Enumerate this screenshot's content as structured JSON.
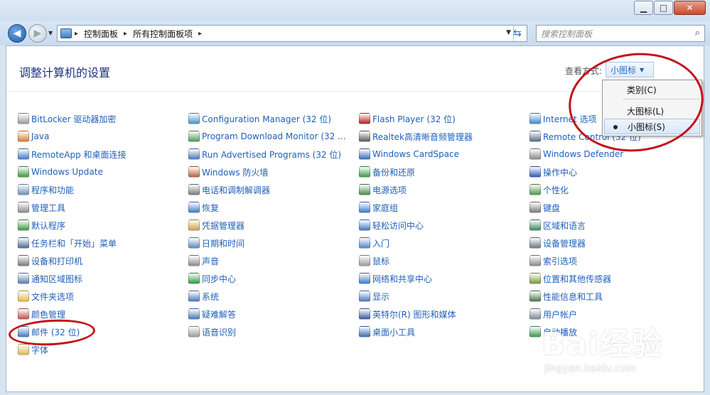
{
  "window": {
    "minimize_glyph": "▁",
    "maximize_glyph": "□",
    "close_glyph": "✕"
  },
  "nav": {
    "back_glyph": "◀",
    "forward_glyph": "▶",
    "breadcrumb": [
      "控制面板",
      "所有控制面板项"
    ],
    "separator": "▸",
    "search_placeholder": "搜索控制面板"
  },
  "header": {
    "title": "调整计算机的设置",
    "view_by_label": "查看方式:",
    "view_selected": "小图标"
  },
  "view_menu": {
    "items": [
      "类别(C)",
      "大图标(L)",
      "小图标(S)"
    ],
    "checked_index": 2
  },
  "columns": [
    [
      {
        "label": "BitLocker 驱动器加密",
        "icon": "bitlocker-icon",
        "color": "#9a9a9a"
      },
      {
        "label": "Java",
        "icon": "java-icon",
        "color": "#e07a2b"
      },
      {
        "label": "RemoteApp 和桌面连接",
        "icon": "remoteapp-icon",
        "color": "#3c7dc4"
      },
      {
        "label": "Windows Update",
        "icon": "windows-update-icon",
        "color": "#3d9a3b"
      },
      {
        "label": "程序和功能",
        "icon": "programs-icon",
        "color": "#6b8fb8"
      },
      {
        "label": "管理工具",
        "icon": "admin-tools-icon",
        "color": "#8a8a8a"
      },
      {
        "label": "默认程序",
        "icon": "default-programs-icon",
        "color": "#3a9a3a"
      },
      {
        "label": "任务栏和「开始」菜单",
        "icon": "taskbar-icon",
        "color": "#4a6a9a"
      },
      {
        "label": "设备和打印机",
        "icon": "printer-icon",
        "color": "#7a7a7a"
      },
      {
        "label": "通知区域图标",
        "icon": "notification-icon",
        "color": "#5a7fb0"
      },
      {
        "label": "文件夹选项",
        "icon": "folder-options-icon",
        "color": "#e2b84a"
      },
      {
        "label": "颜色管理",
        "icon": "color-management-icon",
        "color": "#c0504d"
      },
      {
        "label": "邮件 (32 位)",
        "icon": "mail-icon",
        "color": "#3d7bbf"
      },
      {
        "label": "字体",
        "icon": "fonts-icon",
        "color": "#e2b84a"
      }
    ],
    [
      {
        "label": "Configuration Manager (32 位)",
        "icon": "config-manager-icon",
        "color": "#4a8fc8"
      },
      {
        "label": "Program Download Monitor (32 ...",
        "icon": "download-monitor-icon",
        "color": "#4a9a5a"
      },
      {
        "label": "Run Advertised Programs (32 位)",
        "icon": "run-programs-icon",
        "color": "#4a7ab8"
      },
      {
        "label": "Windows 防火墙",
        "icon": "firewall-icon",
        "color": "#b8643a"
      },
      {
        "label": "电话和调制解调器",
        "icon": "modem-icon",
        "color": "#7a7a7a"
      },
      {
        "label": "恢复",
        "icon": "recovery-icon",
        "color": "#3a7ac8"
      },
      {
        "label": "凭据管理器",
        "icon": "credential-icon",
        "color": "#c8a040"
      },
      {
        "label": "日期和时间",
        "icon": "clock-icon",
        "color": "#5a8ac0"
      },
      {
        "label": "声音",
        "icon": "speaker-icon",
        "color": "#8a8a8a"
      },
      {
        "label": "同步中心",
        "icon": "sync-icon",
        "color": "#2e9a3e"
      },
      {
        "label": "系统",
        "icon": "system-icon",
        "color": "#4a7ab8"
      },
      {
        "label": "疑难解答",
        "icon": "troubleshoot-icon",
        "color": "#4a7ab8"
      },
      {
        "label": "语音识别",
        "icon": "microphone-icon",
        "color": "#9a9a9a"
      }
    ],
    [
      {
        "label": "Flash Player (32 位)",
        "icon": "flash-icon",
        "color": "#b21f1f"
      },
      {
        "label": "Realtek高清晰音频管理器",
        "icon": "realtek-icon",
        "color": "#5a5a5a"
      },
      {
        "label": "Windows CardSpace",
        "icon": "cardspace-icon",
        "color": "#3a6ab8"
      },
      {
        "label": "备份和还原",
        "icon": "backup-icon",
        "color": "#3a9a4a"
      },
      {
        "label": "电源选项",
        "icon": "power-icon",
        "color": "#4a8a4a"
      },
      {
        "label": "家庭组",
        "icon": "homegroup-icon",
        "color": "#3a7ac8"
      },
      {
        "label": "轻松访问中心",
        "icon": "ease-of-access-icon",
        "color": "#3a7ac8"
      },
      {
        "label": "入门",
        "icon": "getting-started-icon",
        "color": "#4a8ac8"
      },
      {
        "label": "鼠标",
        "icon": "mouse-icon",
        "color": "#9a9a9a"
      },
      {
        "label": "网络和共享中心",
        "icon": "network-icon",
        "color": "#3a7ac8"
      },
      {
        "label": "显示",
        "icon": "display-icon",
        "color": "#4a7ab8"
      },
      {
        "label": "英特尔(R) 图形和媒体",
        "icon": "intel-icon",
        "color": "#3a5a9a"
      },
      {
        "label": "桌面小工具",
        "icon": "gadgets-icon",
        "color": "#3a6ab8"
      }
    ],
    [
      {
        "label": "Internet 选项",
        "icon": "internet-options-icon",
        "color": "#3a8ac8"
      },
      {
        "label": "Remote Control (32 位)",
        "icon": "remote-control-icon",
        "color": "#5a6a8a"
      },
      {
        "label": "Windows Defender",
        "icon": "defender-icon",
        "color": "#8a8a8a"
      },
      {
        "label": "操作中心",
        "icon": "action-center-icon",
        "color": "#2a5ab8"
      },
      {
        "label": "个性化",
        "icon": "personalization-icon",
        "color": "#4a9a4a"
      },
      {
        "label": "键盘",
        "icon": "keyboard-icon",
        "color": "#7a7a7a"
      },
      {
        "label": "区域和语言",
        "icon": "region-icon",
        "color": "#3a8a5a"
      },
      {
        "label": "设备管理器",
        "icon": "device-manager-icon",
        "color": "#6a7a8a"
      },
      {
        "label": "索引选项",
        "icon": "indexing-icon",
        "color": "#8a8a8a"
      },
      {
        "label": "位置和其他传感器",
        "icon": "sensor-icon",
        "color": "#7a9a3a"
      },
      {
        "label": "性能信息和工具",
        "icon": "performance-icon",
        "color": "#4a7a4a"
      },
      {
        "label": "用户帐户",
        "icon": "user-accounts-icon",
        "color": "#7a8a9a"
      },
      {
        "label": "自动播放",
        "icon": "autoplay-icon",
        "color": "#3a9a4a"
      }
    ]
  ],
  "watermark": {
    "brand": "Bai经验",
    "url": "jingyan.baidu.com"
  }
}
